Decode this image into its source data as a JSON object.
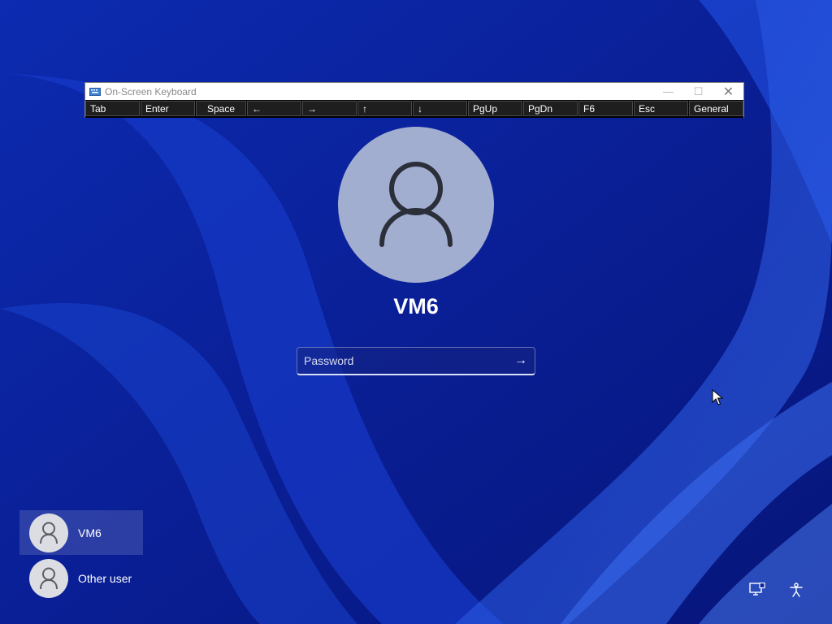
{
  "osk": {
    "title": "On-Screen Keyboard",
    "keys": [
      {
        "label": "Tab"
      },
      {
        "label": "Enter"
      },
      {
        "label": "Space"
      },
      {
        "label": "←"
      },
      {
        "label": "→"
      },
      {
        "label": "↑"
      },
      {
        "label": "↓"
      },
      {
        "label": "PgUp"
      },
      {
        "label": "PgDn"
      },
      {
        "label": "F6"
      },
      {
        "label": "Esc"
      },
      {
        "label": "General"
      }
    ],
    "controls": {
      "minimize": "—",
      "maximize": "☐",
      "close": "✕"
    }
  },
  "login": {
    "user_name": "VM6",
    "password_placeholder": "Password",
    "submit_glyph": "→"
  },
  "users": [
    {
      "name": "VM6",
      "selected": true
    },
    {
      "name": "Other user",
      "selected": false
    }
  ],
  "corner_icons": [
    "network-icon",
    "accessibility-icon"
  ],
  "colors": {
    "wallpaper_base": "#0a1f9a",
    "avatar_bg": "#a2aed0",
    "osk_key_bg": "#1e1e1e"
  }
}
